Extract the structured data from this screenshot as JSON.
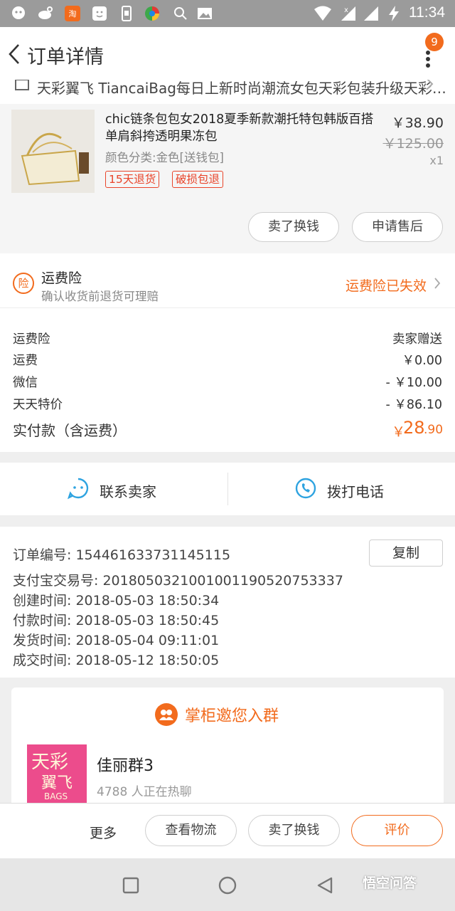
{
  "status_bar": {
    "time": "11:34",
    "icons": [
      "qq-icon",
      "weibo-icon",
      "taobao-icon",
      "message-icon",
      "sim-icon",
      "browser-icon",
      "search-icon",
      "image-icon",
      "wifi-icon",
      "signal-icon",
      "charging-icon"
    ]
  },
  "header": {
    "title": "订单详情",
    "badge_count": "9"
  },
  "shop": {
    "name": "天彩翼飞 TiancaiBag每日上新时尚潮流女包天彩包装升级天彩…"
  },
  "product": {
    "name": "chic链条包包女2018夏季新款潮托特包韩版百搭单肩斜挎透明果冻包",
    "variant": "颜色分类:金色[送钱包]",
    "tags": [
      "15天退货",
      "破损包退"
    ],
    "price": "￥38.90",
    "original_price": "￥125.00",
    "quantity": "x1",
    "buttons": [
      "卖了换钱",
      "申请售后"
    ]
  },
  "insurance": {
    "icon_text": "险",
    "title": "运费险",
    "subtitle": "确认收货前退货可理赔",
    "status": "运费险已失效"
  },
  "costs": {
    "rows": [
      {
        "label": "运费险",
        "value": "卖家赠送"
      },
      {
        "label": "运费",
        "value": "￥0.00"
      },
      {
        "label": "微信",
        "value": "- ￥10.00"
      },
      {
        "label": "天天特价",
        "value": "- ￥86.10"
      }
    ],
    "total_label": "实付款（含运费）",
    "total_symbol": "￥",
    "total_integer": "28",
    "total_decimal": ".90"
  },
  "contact": {
    "seller_label": "联系卖家",
    "phone_label": "拨打电话"
  },
  "order_info": {
    "order_no": "订单编号:   1544616337311451​15",
    "copy_label": "复制",
    "alipay_no": "支付宝交易号:   2018050321001001190520753337",
    "created": "创建时间:   2018-05-03 18:50:34",
    "paid": "付款时间:   2018-05-03 18:50:45",
    "shipped": "发货时间:   2018-05-04 09:11:01",
    "completed": "成交时间:   2018-05-12 18:50:05"
  },
  "group": {
    "title": "掌柜邀您入群",
    "name": "佳丽群3",
    "subtitle": "4788 人正在热聊",
    "logo_text_top": "天彩",
    "logo_text_mid": "翼飞",
    "logo_text_bottom": "BAGS"
  },
  "bottom_bar": {
    "more": "更多",
    "logistics": "查看物流",
    "sell": "卖了换钱",
    "review": "评价"
  },
  "watermark": "悟空问答",
  "colors": {
    "accent": "#f26b1d",
    "tag_red": "#e9452b",
    "status_bar": "#9b9b9b"
  }
}
